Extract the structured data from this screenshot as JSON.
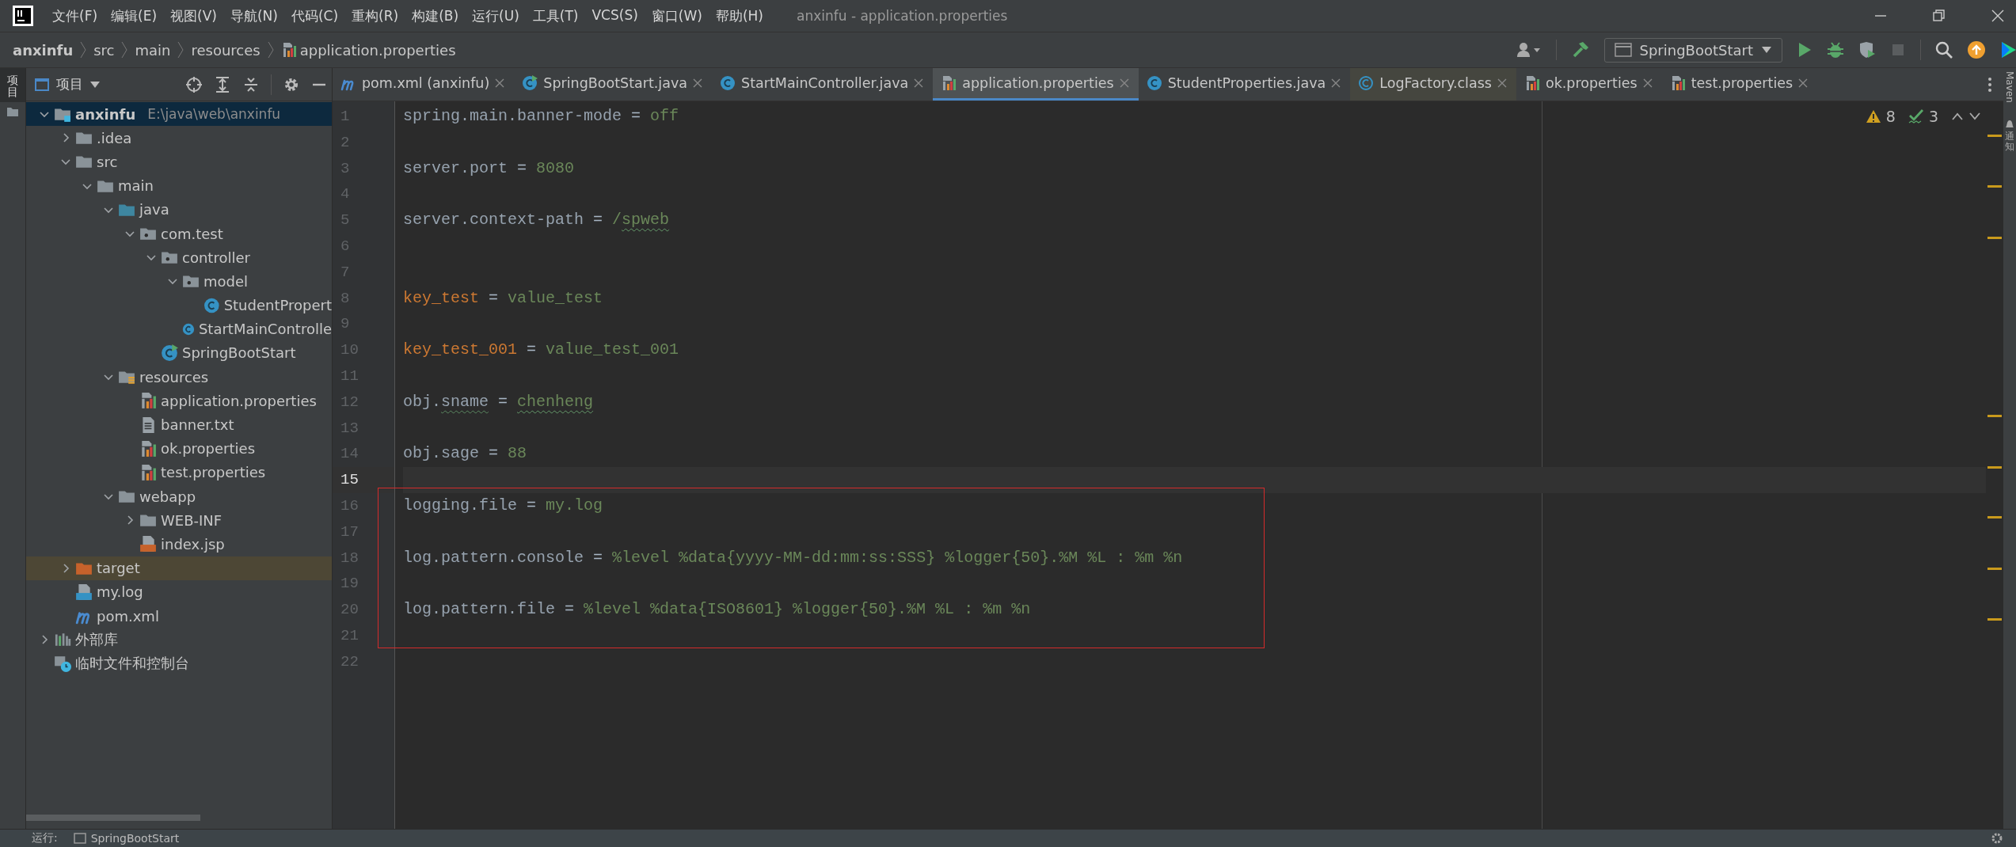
{
  "window": {
    "title": "anxinfu - application.properties",
    "menu": [
      "文件(F)",
      "编辑(E)",
      "视图(V)",
      "导航(N)",
      "代码(C)",
      "重构(R)",
      "构建(B)",
      "运行(U)",
      "工具(T)",
      "VCS(S)",
      "窗口(W)",
      "帮助(H)"
    ]
  },
  "breadcrumb": [
    {
      "label": "anxinfu",
      "kind": "project"
    },
    {
      "label": "src",
      "kind": "folder"
    },
    {
      "label": "main",
      "kind": "folder"
    },
    {
      "label": "resources",
      "kind": "folder"
    },
    {
      "label": "application.properties",
      "kind": "file"
    }
  ],
  "toolbar": {
    "run_configuration": "SpringBootStart"
  },
  "left_stripe": {
    "label": "项目"
  },
  "project_panel": {
    "title": "项目",
    "tree": [
      {
        "label": "anxinfu",
        "path": "E:\\java\\web\\anxinfu",
        "kind": "module-folder",
        "expanded": true,
        "selected": true,
        "children": [
          {
            "label": ".idea",
            "kind": "folder",
            "expanded": false,
            "selected": false
          },
          {
            "label": "src",
            "kind": "folder",
            "expanded": true,
            "selected": false,
            "children": [
              {
                "label": "main",
                "kind": "folder",
                "expanded": true,
                "selected": false,
                "children": [
                  {
                    "label": "java",
                    "kind": "source-folder",
                    "expanded": true,
                    "selected": false,
                    "children": [
                      {
                        "label": "com.test",
                        "kind": "package",
                        "expanded": true,
                        "selected": false,
                        "children": [
                          {
                            "label": "controller",
                            "kind": "package",
                            "expanded": true,
                            "selected": false,
                            "children": [
                              {
                                "label": "model",
                                "kind": "package",
                                "expanded": true,
                                "selected": false,
                                "children": [
                                  {
                                    "label": "StudentPropert",
                                    "kind": "class",
                                    "selected": false
                                  }
                                ]
                              },
                              {
                                "label": "StartMainControlle",
                                "kind": "class",
                                "selected": false
                              }
                            ]
                          },
                          {
                            "label": "SpringBootStart",
                            "kind": "main-class",
                            "selected": false
                          }
                        ]
                      }
                    ]
                  },
                  {
                    "label": "resources",
                    "kind": "resources-folder",
                    "expanded": true,
                    "selected": false,
                    "children": [
                      {
                        "label": "application.properties",
                        "kind": "properties",
                        "selected": false
                      },
                      {
                        "label": "banner.txt",
                        "kind": "text-file",
                        "selected": false
                      },
                      {
                        "label": "ok.properties",
                        "kind": "properties",
                        "selected": false
                      },
                      {
                        "label": "test.properties",
                        "kind": "properties",
                        "selected": false
                      }
                    ]
                  },
                  {
                    "label": "webapp",
                    "kind": "folder",
                    "expanded": true,
                    "selected": false,
                    "children": [
                      {
                        "label": "WEB-INF",
                        "kind": "folder",
                        "expanded": false,
                        "selected": false
                      },
                      {
                        "label": "index.jsp",
                        "kind": "jsp",
                        "selected": false
                      }
                    ]
                  }
                ]
              }
            ]
          },
          {
            "label": "target",
            "kind": "excluded-folder",
            "expanded": false,
            "selected": false,
            "highlighted": true
          },
          {
            "label": "my.log",
            "kind": "log-file",
            "selected": false
          },
          {
            "label": "pom.xml",
            "kind": "maven",
            "selected": false
          }
        ]
      },
      {
        "label": "外部库",
        "kind": "library",
        "expanded": false,
        "selected": false
      },
      {
        "label": "临时文件和控制台",
        "kind": "scratches",
        "selected": false
      }
    ]
  },
  "editor": {
    "tabs": [
      {
        "label": "pom.xml (anxinfu)",
        "kind": "maven",
        "selected": false
      },
      {
        "label": "SpringBootStart.java",
        "kind": "main-class",
        "selected": false
      },
      {
        "label": "StartMainController.java",
        "kind": "class",
        "selected": false
      },
      {
        "label": "application.properties",
        "kind": "properties",
        "selected": true
      },
      {
        "label": "StudentProperties.java",
        "kind": "class",
        "selected": false
      },
      {
        "label": "LogFactory.class",
        "kind": "class-readonly",
        "selected": false
      },
      {
        "label": "ok.properties",
        "kind": "properties",
        "selected": false
      },
      {
        "label": "test.properties",
        "kind": "properties",
        "selected": false
      }
    ],
    "warnings": "8",
    "typos": "3",
    "lines": [
      {
        "number": "1",
        "current": false,
        "parts": [
          {
            "text": "spring.main.banner-mode",
            "kind": "key"
          },
          {
            "text": " = ",
            "kind": "op"
          },
          {
            "text": "off",
            "kind": "value"
          }
        ]
      },
      {
        "number": "2",
        "current": false
      },
      {
        "number": "3",
        "current": false,
        "parts": [
          {
            "text": "server.port",
            "kind": "key"
          },
          {
            "text": " = ",
            "kind": "op"
          },
          {
            "text": "8080",
            "kind": "value"
          }
        ]
      },
      {
        "number": "4",
        "current": false
      },
      {
        "number": "5",
        "current": false,
        "parts": [
          {
            "text": "server.context-path",
            "kind": "key"
          },
          {
            "text": " = ",
            "kind": "op"
          },
          {
            "text": "/",
            "kind": "value"
          },
          {
            "text": "spweb",
            "kind": "value-typo"
          }
        ]
      },
      {
        "number": "6",
        "current": false
      },
      {
        "number": "7",
        "current": false
      },
      {
        "number": "8",
        "current": false,
        "parts": [
          {
            "text": "key_test",
            "kind": "custom-key"
          },
          {
            "text": " = ",
            "kind": "op"
          },
          {
            "text": "value_test",
            "kind": "value"
          }
        ]
      },
      {
        "number": "9",
        "current": false
      },
      {
        "number": "10",
        "current": false,
        "parts": [
          {
            "text": "key_test_001",
            "kind": "custom-key"
          },
          {
            "text": " = ",
            "kind": "op"
          },
          {
            "text": "value_test_001",
            "kind": "value"
          }
        ]
      },
      {
        "number": "11",
        "current": false
      },
      {
        "number": "12",
        "current": false,
        "parts": [
          {
            "text": "obj.",
            "kind": "key"
          },
          {
            "text": "sname",
            "kind": "key-typo"
          },
          {
            "text": " = ",
            "kind": "op"
          },
          {
            "text": "chenheng",
            "kind": "value-typo"
          }
        ]
      },
      {
        "number": "13",
        "current": false
      },
      {
        "number": "14",
        "current": false,
        "parts": [
          {
            "text": "obj.sage",
            "kind": "key"
          },
          {
            "text": " = ",
            "kind": "op"
          },
          {
            "text": "88",
            "kind": "value"
          }
        ]
      },
      {
        "number": "15",
        "current": true
      },
      {
        "number": "16",
        "current": false,
        "boxed": true,
        "parts": [
          {
            "text": "logging.file",
            "kind": "key"
          },
          {
            "text": " = ",
            "kind": "op"
          },
          {
            "text": "my.log",
            "kind": "value"
          }
        ]
      },
      {
        "number": "17",
        "current": false,
        "boxed": true
      },
      {
        "number": "18",
        "current": false,
        "boxed": true,
        "parts": [
          {
            "text": "log.pattern.console",
            "kind": "key"
          },
          {
            "text": " = ",
            "kind": "op"
          },
          {
            "text": "%level %data{yyyy-MM-dd:mm:ss:SSS} %logger{50}.%M %L : %m %n",
            "kind": "value"
          }
        ]
      },
      {
        "number": "19",
        "current": false,
        "boxed": true
      },
      {
        "number": "20",
        "current": false,
        "boxed": true,
        "parts": [
          {
            "text": "log.pattern.file",
            "kind": "key"
          },
          {
            "text": " = ",
            "kind": "op"
          },
          {
            "text": "%level %data{ISO8601} %logger{50}.%M %L : %m %n",
            "kind": "value"
          }
        ]
      },
      {
        "number": "21",
        "current": false,
        "boxed": true
      },
      {
        "number": "22",
        "current": false
      }
    ]
  },
  "right_stripe": [
    {
      "label": "Maven",
      "kind": "latin"
    },
    {
      "label": "通知",
      "kind": "cjk"
    }
  ],
  "bottom_bar": {
    "label": "运行:",
    "tab": "SpringBootStart"
  }
}
